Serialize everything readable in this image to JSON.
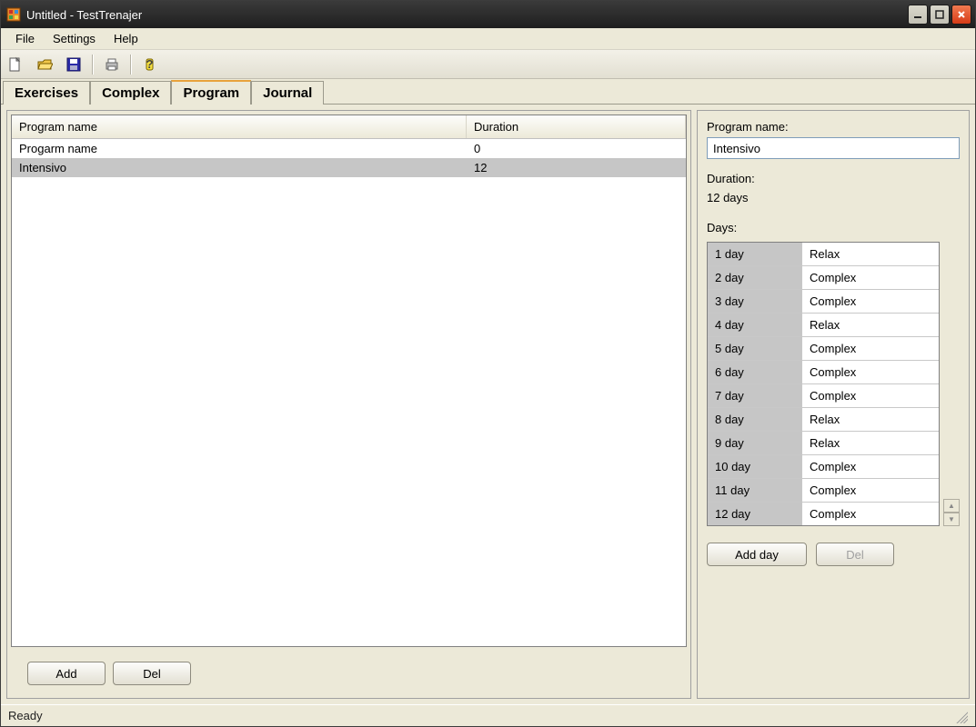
{
  "window": {
    "title": "Untitled - TestTrenajer"
  },
  "menubar": {
    "file": "File",
    "settings": "Settings",
    "help": "Help"
  },
  "toolbar": {
    "new": "new-icon",
    "open": "open-icon",
    "save": "save-icon",
    "print": "print-icon",
    "help": "help-icon"
  },
  "tabs": {
    "exercises": "Exercises",
    "complex": "Complex",
    "program": "Program",
    "journal": "Journal",
    "active": "program"
  },
  "list": {
    "headers": {
      "name": "Program name",
      "duration": "Duration"
    },
    "rows": [
      {
        "name": "Progarm name",
        "duration": "0"
      },
      {
        "name": "Intensivo",
        "duration": "12"
      }
    ],
    "selected_index": 1
  },
  "left_buttons": {
    "add": "Add",
    "del": "Del"
  },
  "details": {
    "name_label": "Program name:",
    "name_value": "Intensivo",
    "duration_label": "Duration:",
    "duration_value": "12 days",
    "days_label": "Days:",
    "days": [
      {
        "day": "1 day",
        "type": "Relax"
      },
      {
        "day": "2 day",
        "type": "Complex"
      },
      {
        "day": "3 day",
        "type": "Complex"
      },
      {
        "day": "4 day",
        "type": "Relax"
      },
      {
        "day": "5 day",
        "type": "Complex"
      },
      {
        "day": "6 day",
        "type": "Complex"
      },
      {
        "day": "7 day",
        "type": "Complex"
      },
      {
        "day": "8 day",
        "type": "Relax"
      },
      {
        "day": "9 day",
        "type": "Relax"
      },
      {
        "day": "10 day",
        "type": "Complex"
      },
      {
        "day": "11 day",
        "type": "Complex"
      },
      {
        "day": "12 day",
        "type": "Complex"
      }
    ],
    "buttons": {
      "add_day": "Add day",
      "del": "Del"
    }
  },
  "statusbar": {
    "text": "Ready"
  }
}
